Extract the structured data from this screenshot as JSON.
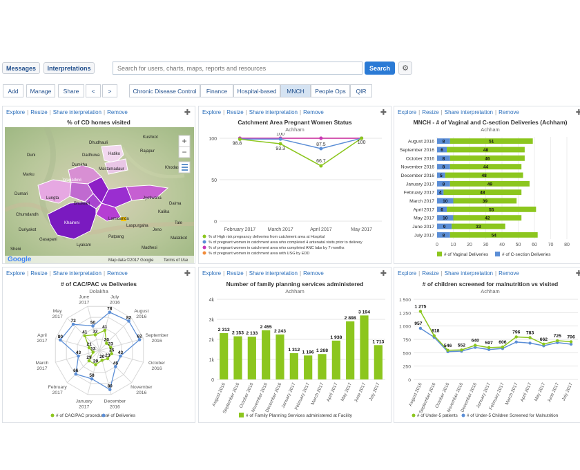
{
  "topbar": {
    "messages": "Messages",
    "interpretations": "Interpretations",
    "search_placeholder": "Search for users, charts, maps, reports and resources",
    "search_button": "Search"
  },
  "toolbar": {
    "add": "Add",
    "manage": "Manage",
    "share": "Share",
    "prev": "<",
    "next": ">"
  },
  "tabs": [
    "Chronic Disease Control",
    "Finance",
    "Hospital-based",
    "MNCH",
    "People Ops",
    "QIR"
  ],
  "panel_actions": {
    "explore": "Explore",
    "resize": "Resize",
    "share": "Share interpretation",
    "remove": "Remove"
  },
  "map": {
    "title": "% of CD homes visited",
    "zoom_in": "+",
    "zoom_out": "−",
    "attribution": "Map data ©2017 Google",
    "terms": "Terms of Use",
    "logo": "Google",
    "place_labels": [
      "Kushkot",
      "Dhudhauli",
      "Hatiko",
      "Dadhuwa",
      "Dumkha",
      "Mastamadaur",
      "Khodasa",
      "Duni",
      "Marku",
      "Jalapadevi",
      "Lungta",
      "Jyotiwana",
      "Lamidanda",
      "Bhulwari",
      "Khaireni",
      "Duriyakot",
      "Chumdandh",
      "Kalika",
      "Daima",
      "Tale",
      "Malatikot",
      "Sheni",
      "Madhesi",
      "Jeno",
      "Dumari",
      "Laspurgaha",
      "Lyakam",
      "Gasapani",
      "Patpang",
      "Rajapur"
    ]
  },
  "chart_data": [
    {
      "type": "line",
      "title": "Catchment Area Pregnant Women Status",
      "subtitle": "Achham",
      "categories": [
        "February 2017",
        "March 2017",
        "April 2017",
        "May 2017"
      ],
      "ylim": [
        0,
        100
      ],
      "yticks": [
        0,
        50,
        100
      ],
      "series": [
        {
          "name": "% of High risk pregnancy deliveries from catchment area at Hospital",
          "color": "#8cc61e",
          "values": [
            98.8,
            93.3,
            66.7,
            100
          ]
        },
        {
          "name": "% of pregnant women in catchment area who completed 4 antenatal visits prior to delivery",
          "color": "#5b8ed6",
          "values": [
            99,
            99,
            87.5,
            100
          ]
        },
        {
          "name": "% of pregnant women in catchment area who completed ANC labs by 7 months",
          "color": "#c737b8",
          "values": [
            100,
            100,
            100,
            100
          ]
        },
        {
          "name": "% of pregnant women in catchment area with USG by EDD",
          "color": "#f28c3a",
          "values": [
            100,
            100,
            100,
            100
          ]
        }
      ],
      "labels": [
        "98.8",
        "100",
        "93.3",
        "87.5",
        "66.7",
        "100"
      ]
    },
    {
      "type": "bar",
      "title": "MNCH - # of Vaginal and C-section Deliveries (Achham)",
      "subtitle": "Achham",
      "orientation": "horizontal",
      "stacked": true,
      "categories": [
        "August 2016",
        "September 2016",
        "October 2016",
        "November 2016",
        "December 2016",
        "January 2017",
        "February 2017",
        "March 2017",
        "April 2017",
        "May 2017",
        "June 2017",
        "July 2017"
      ],
      "xlim": [
        0,
        80
      ],
      "xticks": [
        0,
        10,
        20,
        30,
        40,
        50,
        60,
        70,
        80
      ],
      "series": [
        {
          "name": "# of C-section Deliveries",
          "color": "#5b8ed6",
          "values": [
            8,
            6,
            8,
            8,
            5,
            8,
            4,
            10,
            6,
            10,
            9,
            8
          ]
        },
        {
          "name": "# of Vaginal Deliveries",
          "color": "#8cc61e",
          "values": [
            51,
            48,
            46,
            44,
            48,
            49,
            48,
            39,
            55,
            42,
            33,
            54
          ]
        }
      ]
    },
    {
      "type": "radar",
      "title": "# of CAC/PAC vs Deliveries",
      "subtitle": "Dolakha",
      "categories": [
        "July 2016",
        "August 2016",
        "September 2016",
        "October 2016",
        "November 2016",
        "December 2016",
        "January 2017",
        "February 2017",
        "March 2017",
        "April 2017",
        "May 2017",
        "June 2017"
      ],
      "rlim": [
        0,
        90
      ],
      "series": [
        {
          "name": "# of CAC/PAC procedures",
          "color": "#8cc61e",
          "values": [
            41,
            20,
            23,
            25,
            23,
            20,
            29,
            29,
            13,
            21,
            41,
            32
          ]
        },
        {
          "name": "# of Deliveries",
          "color": "#5b8ed6",
          "values": [
            78,
            82,
            82,
            43,
            45,
            80,
            58,
            66,
            43,
            80,
            73,
            50
          ]
        }
      ]
    },
    {
      "type": "bar",
      "title": "Number of family planning services administered",
      "subtitle": "Achham",
      "categories": [
        "August 2016",
        "September 2016",
        "October 2016",
        "November 2016",
        "December 2016",
        "January 2017",
        "February 2017",
        "March 2017",
        "April 2017",
        "May 2017",
        "June 2017",
        "July 2017"
      ],
      "ylim": [
        0,
        4000
      ],
      "yticks": [
        "0",
        "1k",
        "2k",
        "3k",
        "4k"
      ],
      "series": [
        {
          "name": "# of Family Planning Services administered at Facility",
          "color": "#8cc61e",
          "values": [
            2313,
            2153,
            2133,
            2455,
            2243,
            1312,
            1196,
            1268,
            1938,
            2898,
            3194,
            1713
          ]
        }
      ],
      "labels": [
        "2 313",
        "2 153",
        "2 133",
        "2 455",
        "2 243",
        "1 312",
        "1 196",
        "1 268",
        "1 938",
        "2 898",
        "3 194",
        "1 713"
      ]
    },
    {
      "type": "line",
      "title": "# of children screened for malnutrition vs visited",
      "subtitle": "Achham",
      "categories": [
        "August 2016",
        "September 2016",
        "October 2016",
        "November 2016",
        "December 2016",
        "January 2017",
        "February 2017",
        "March 2017",
        "April 2017",
        "May 2017",
        "June 2017",
        "July 2017"
      ],
      "ylim": [
        0,
        1500
      ],
      "yticks": [
        "0",
        "250",
        "500",
        "750",
        "1 000",
        "1 250",
        "1 500"
      ],
      "series": [
        {
          "name": "# of Under-5 patients",
          "color": "#8cc61e",
          "values": [
            1275,
            818,
            546,
            552,
            640,
            597,
            606,
            796,
            783,
            662,
            725,
            706
          ]
        },
        {
          "name": "# of Under-5 Children Screened for Malnutrition",
          "color": "#5b8ed6",
          "values": [
            957,
            790,
            520,
            530,
            600,
            560,
            580,
            700,
            680,
            630,
            690,
            660
          ]
        }
      ],
      "labels": [
        "1 275",
        "957",
        "818",
        "546",
        "552",
        "640",
        "597",
        "606",
        "796",
        "783",
        "662",
        "725",
        "706"
      ]
    }
  ]
}
